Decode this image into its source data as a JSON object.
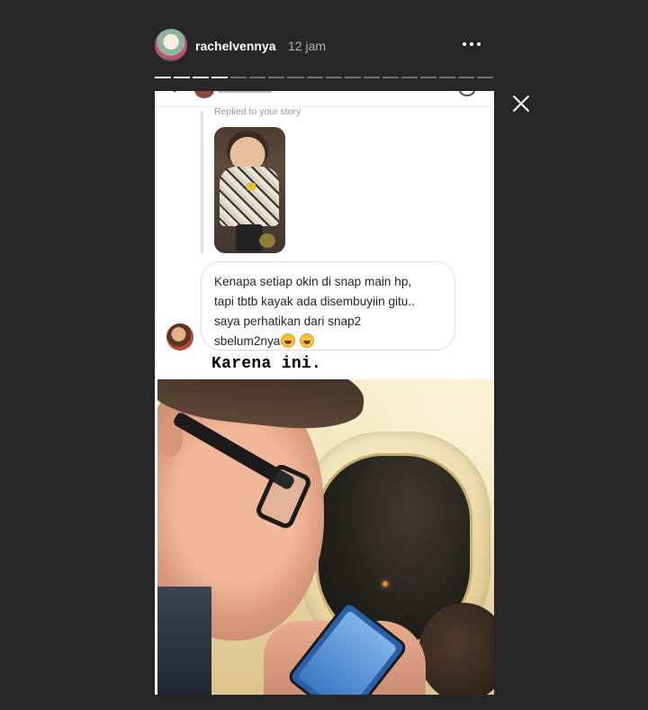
{
  "header": {
    "username": "rachelvennya",
    "time": "12 jam",
    "more_icon": "more-horizontal-icon",
    "close_icon": "close-icon"
  },
  "progress": {
    "segments": 18,
    "completed": 4
  },
  "story": {
    "replied_label": "Replied to your story",
    "message_lines": [
      "Kenapa setiap okin di snap main hp,",
      "tapi tbtb kayak ada disembuyiin gitu..",
      "saya perhatikan dari snap2",
      "sbelum2nya"
    ],
    "message_emoji": "grinning-sweat-emoji",
    "caption": "Karena ini."
  }
}
